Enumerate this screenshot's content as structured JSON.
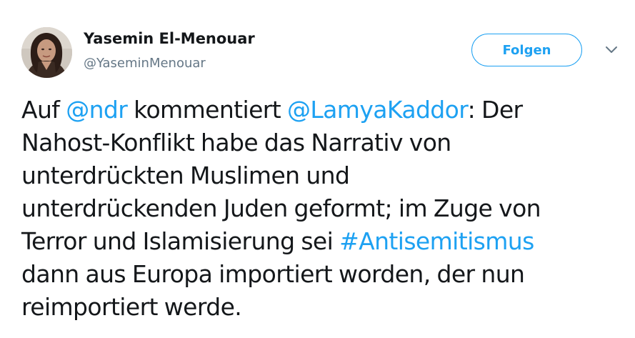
{
  "author": {
    "name": "Yasemin El-Menouar",
    "handle": "@YaseminMenouar"
  },
  "follow_button": {
    "label": "Folgen"
  },
  "tweet": {
    "lines": [
      [
        {
          "type": "text",
          "text": "Auf "
        },
        {
          "type": "mention",
          "text": "@ndr"
        },
        {
          "type": "text",
          "text": " kommentiert "
        },
        {
          "type": "mention",
          "text": "@LamyaKaddor"
        },
        {
          "type": "text",
          "text": ": Der"
        }
      ],
      [
        {
          "type": "text",
          "text": "Nahost-Konflikt habe das Narrativ von"
        }
      ],
      [
        {
          "type": "text",
          "text": "unterdrückten Muslimen und"
        }
      ],
      [
        {
          "type": "text",
          "text": "unterdrückenden Juden geformt; im Zuge von"
        }
      ],
      [
        {
          "type": "text",
          "text": "Terror und Islamisierung sei "
        },
        {
          "type": "hashtag",
          "text": "#Antisemitismus"
        }
      ],
      [
        {
          "type": "text",
          "text": "dann aus Europa importiert worden, der nun"
        }
      ],
      [
        {
          "type": "text",
          "text": "reimportiert werde."
        }
      ]
    ]
  },
  "icons": {
    "menu": "chevron-down-icon",
    "avatar": "profile-photo"
  },
  "colors": {
    "link": "#1da1f2",
    "text": "#14171a",
    "secondary": "#657786"
  }
}
